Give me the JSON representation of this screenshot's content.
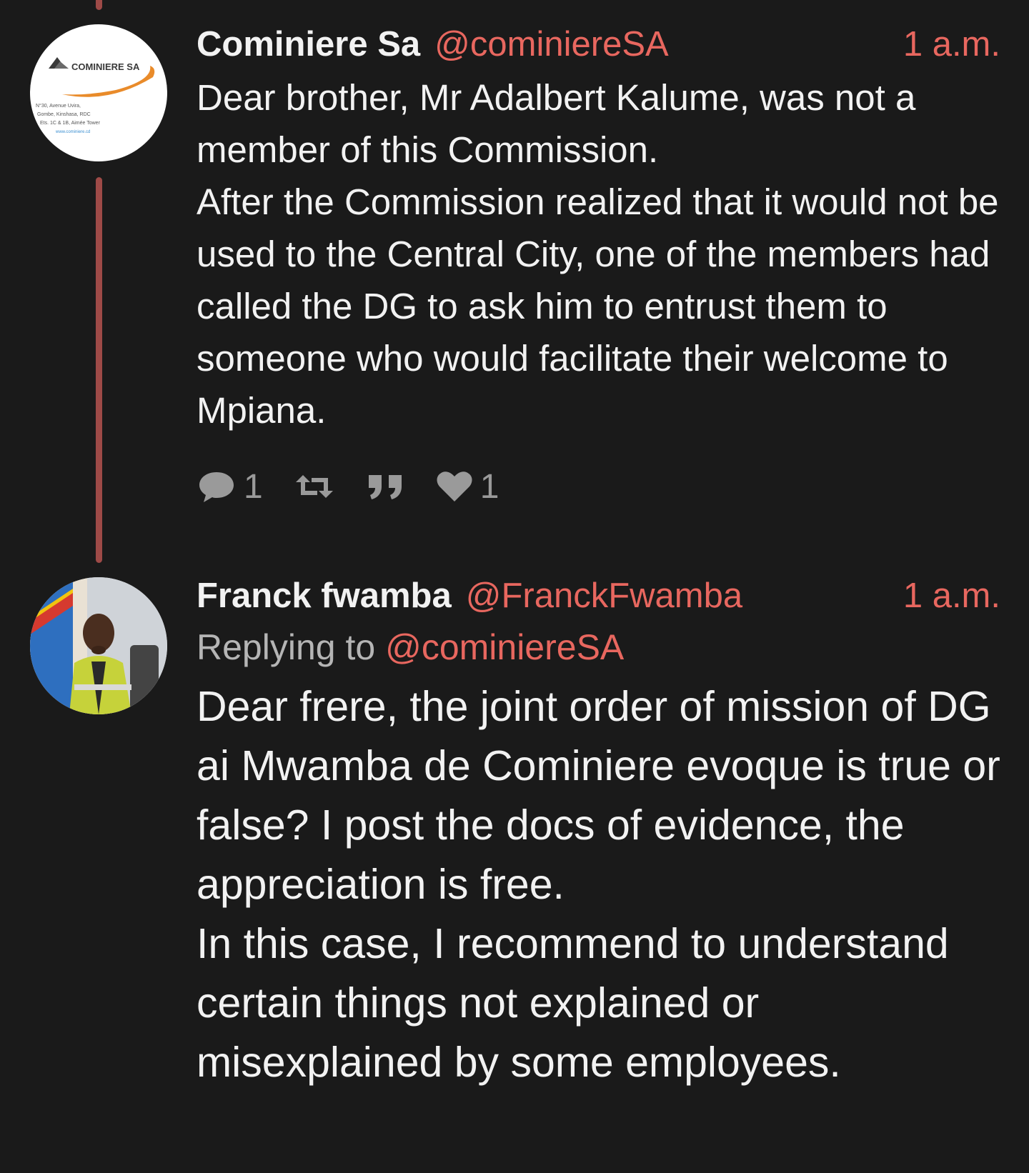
{
  "tweets": [
    {
      "author_name": "Cominiere Sa",
      "handle": "@cominiereSA",
      "time": "1 a.m.",
      "avatar": {
        "icon": "cominiere-logo-icon",
        "logo_text": "COMINIERE SA",
        "address_lines": [
          "N°30, Avenue Uvira,",
          "Gombe, Kinshasa, RDC",
          "Ets. 1C & 1B, Aimée Tower",
          "www.cominiere.cd"
        ]
      },
      "body": "Dear brother, Mr Adalbert Kalume, was not a member of this Commission.\nAfter the Commission realized that it would not be used to the Central City, one of the members had called the DG to ask him to entrust them to someone who would facilitate their welcome to Mpiana.",
      "actions": {
        "reply_count": "1",
        "like_count": "1"
      }
    },
    {
      "author_name": "Franck fwamba",
      "handle": "@FranckFwamba",
      "time": "1 a.m.",
      "avatar": {
        "icon": "user-photo-avatar"
      },
      "replying_prefix": "Replying to",
      "replying_handle": "@cominiereSA",
      "body": "Dear frere, the joint order of mission of DG ai Mwamba de Cominiere evoque is true or false? I post the docs of evidence, the appreciation is free.\nIn this case, I recommend to understand certain things not explained or misexplained by some employees."
    }
  ],
  "colors": {
    "background": "#1a1a1a",
    "accent": "#e8675f",
    "thread_line": "#9e4a47",
    "muted": "#9a9a9a",
    "text": "#f2f2f2"
  }
}
